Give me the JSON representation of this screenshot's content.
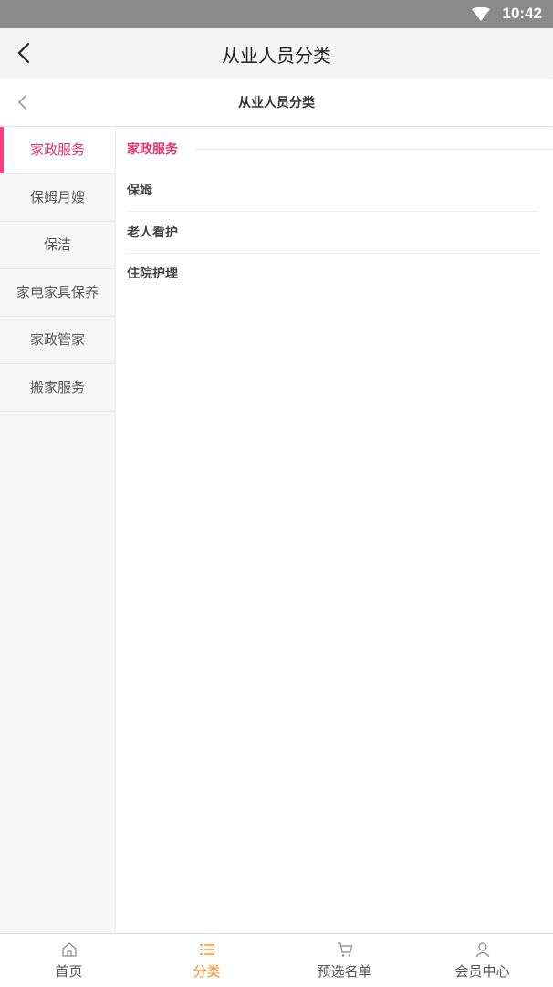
{
  "status": {
    "time": "10:42"
  },
  "header": {
    "title": "从业人员分类"
  },
  "subheader": {
    "title": "从业人员分类"
  },
  "sidebar": {
    "items": [
      {
        "label": "家政服务"
      },
      {
        "label": "保姆月嫂"
      },
      {
        "label": "保洁"
      },
      {
        "label": "家电家具保养"
      },
      {
        "label": "家政管家"
      },
      {
        "label": "搬家服务"
      }
    ]
  },
  "content": {
    "section_title": "家政服务",
    "items": [
      {
        "label": "保姆"
      },
      {
        "label": "老人看护"
      },
      {
        "label": "住院护理"
      }
    ]
  },
  "tabbar": {
    "items": [
      {
        "label": "首页",
        "icon": "home-icon"
      },
      {
        "label": "分类",
        "icon": "list-icon"
      },
      {
        "label": "预选名单",
        "icon": "cart-icon"
      },
      {
        "label": "会员中心",
        "icon": "user-icon"
      }
    ]
  },
  "colors": {
    "accent_pink": "#e8336f",
    "accent_orange": "#ff8a1f"
  }
}
